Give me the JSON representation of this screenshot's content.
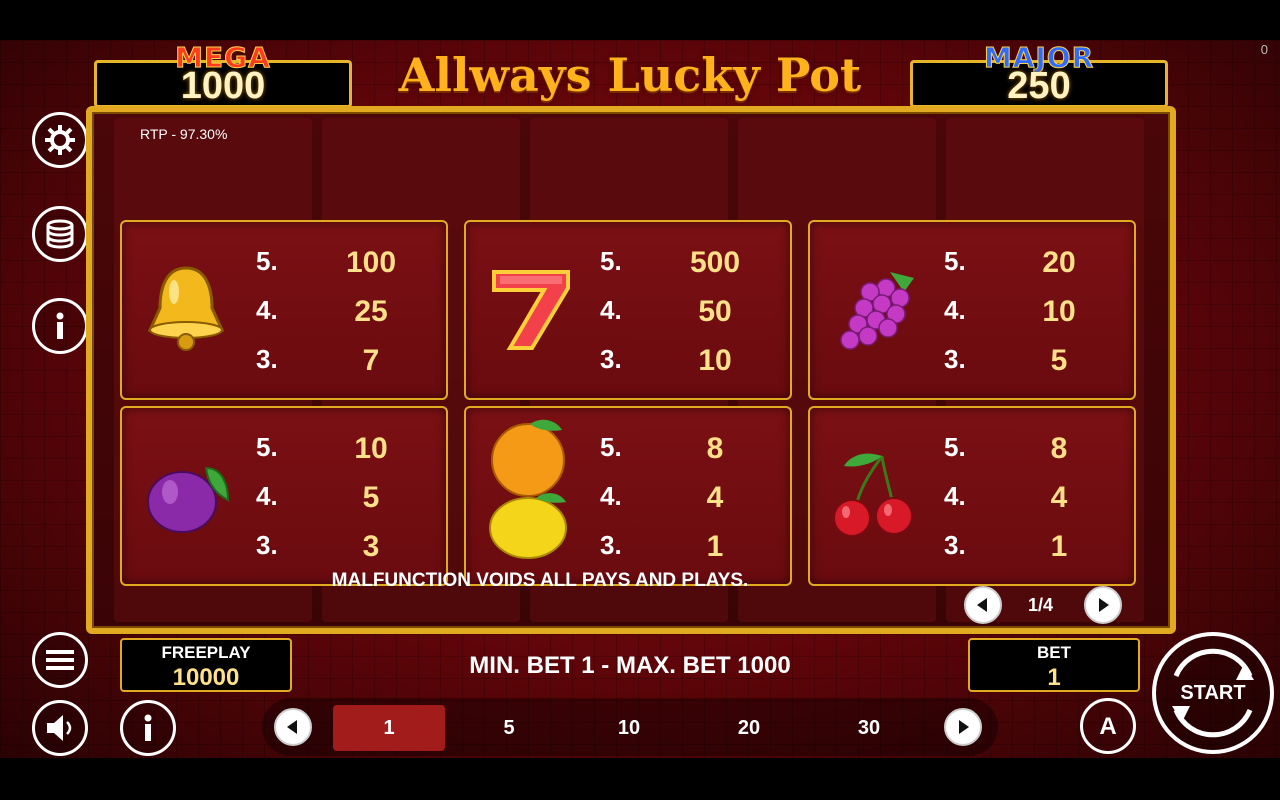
{
  "title": "Allways Lucky Pot",
  "corner_counter": "0",
  "jackpots": {
    "mega": {
      "label": "MEGA",
      "value": "1000"
    },
    "major": {
      "label": "MAJOR",
      "value": "250"
    }
  },
  "rtp": "RTP - 97.30%",
  "paytable": [
    {
      "symbol": "bell-icon",
      "rows": [
        [
          "5.",
          "100"
        ],
        [
          "4.",
          "25"
        ],
        [
          "3.",
          "7"
        ]
      ]
    },
    {
      "symbol": "seven-icon",
      "rows": [
        [
          "5.",
          "500"
        ],
        [
          "4.",
          "50"
        ],
        [
          "3.",
          "10"
        ]
      ]
    },
    {
      "symbol": "grapes-icon",
      "rows": [
        [
          "5.",
          "20"
        ],
        [
          "4.",
          "10"
        ],
        [
          "3.",
          "5"
        ]
      ]
    },
    {
      "symbol": "plum-icon",
      "rows": [
        [
          "5.",
          "10"
        ],
        [
          "4.",
          "5"
        ],
        [
          "3.",
          "3"
        ]
      ]
    },
    {
      "symbol": "orange-lemon-icon",
      "rows": [
        [
          "5.",
          "8"
        ],
        [
          "4.",
          "4"
        ],
        [
          "3.",
          "1"
        ]
      ]
    },
    {
      "symbol": "cherry-icon",
      "rows": [
        [
          "5.",
          "8"
        ],
        [
          "4.",
          "4"
        ],
        [
          "3.",
          "1"
        ]
      ]
    }
  ],
  "notice": "MALFUNCTION VOIDS ALL PAYS AND PLAYS.",
  "page_indicator": "1/4",
  "freeplay": {
    "label": "FREEPLAY",
    "value": "10000"
  },
  "bet_limits": "MIN. BET 1 - MAX. BET 1000",
  "bet": {
    "label": "BET",
    "value": "1"
  },
  "bet_options": [
    "1",
    "5",
    "10",
    "20",
    "30"
  ],
  "selected_bet": "1",
  "start_label": "START",
  "auto_label": "A",
  "colors": {
    "gold": "#e2aa20",
    "card_bg": "#6a0b0f",
    "value_text": "#ffe08a",
    "selected_bet": "#a31c1c"
  }
}
